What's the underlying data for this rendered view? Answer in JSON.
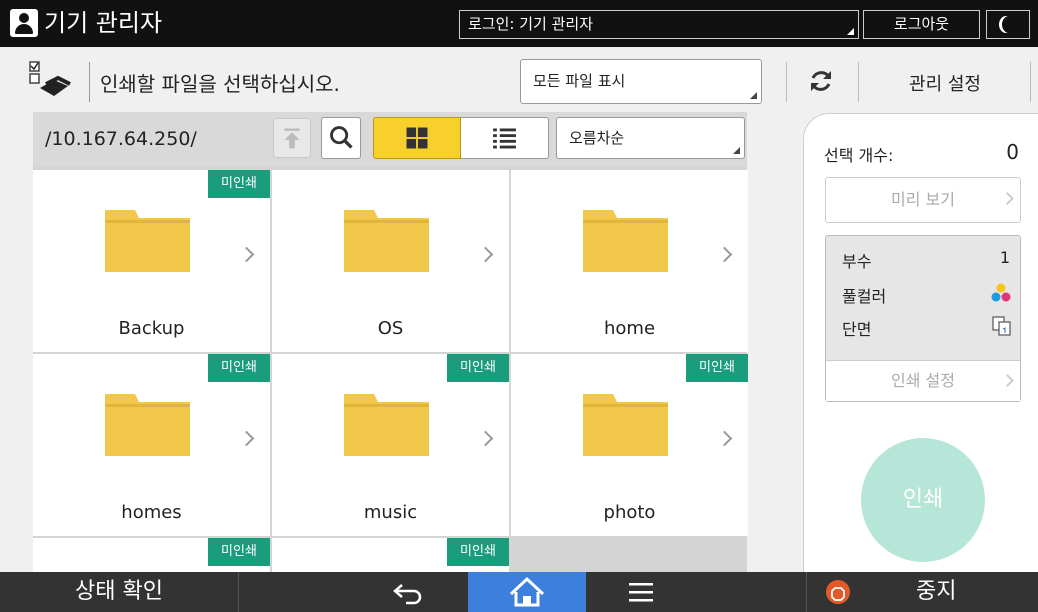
{
  "topbar": {
    "title": "기기 관리자",
    "login_status": "로그인: 기기 관리자",
    "logout_label": "로그아웃"
  },
  "header": {
    "instruction": "인쇄할 파일을 선택하십시오.",
    "filter_value": "모든 파일 표시",
    "admin_settings_label": "관리 설정"
  },
  "browser": {
    "path": "/10.167.64.250/",
    "sort_value": "오름차순",
    "view_mode": "grid",
    "items": [
      {
        "name": "Backup",
        "badge": "미인쇄"
      },
      {
        "name": "OS",
        "badge": ""
      },
      {
        "name": "home",
        "badge": ""
      },
      {
        "name": "homes",
        "badge": "미인쇄"
      },
      {
        "name": "music",
        "badge": "미인쇄"
      },
      {
        "name": "photo",
        "badge": "미인쇄"
      },
      {
        "name": "",
        "badge": "미인쇄"
      },
      {
        "name": "",
        "badge": "미인쇄"
      }
    ]
  },
  "side": {
    "selected_label": "선택 개수:",
    "selected_count": "0",
    "preview_label": "미리 보기",
    "copies_label": "부수",
    "copies_value": "1",
    "color_label": "풀컬러",
    "sides_label": "단면",
    "print_settings_label": "인쇄 설정",
    "print_label": "인쇄"
  },
  "bottombar": {
    "status_label": "상태 확인",
    "stop_label": "중지"
  },
  "colors": {
    "badge": "#1a9d7c",
    "grid_toggle_active": "#f7d02b",
    "home_active": "#3d7fdd",
    "print_button": "#b6e6d8",
    "stop_icon": "#e25a2a",
    "folder": "#f1c84a"
  }
}
